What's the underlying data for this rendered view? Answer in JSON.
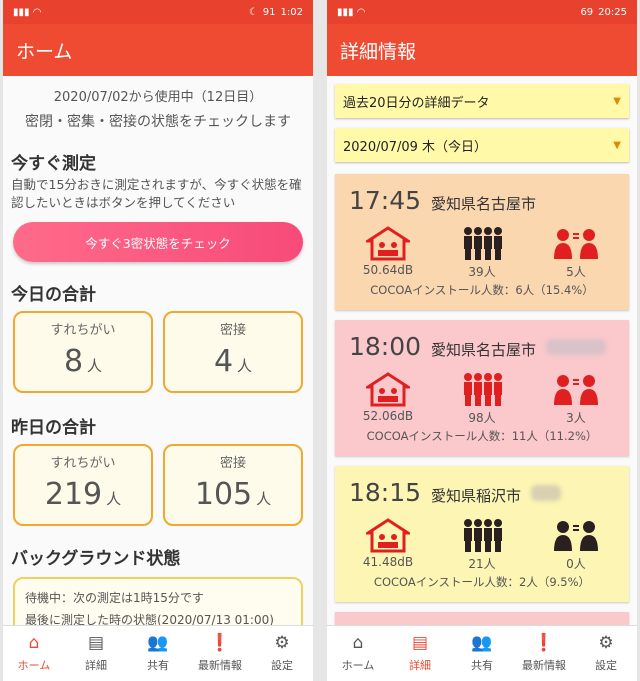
{
  "left": {
    "status": {
      "time": "1:02",
      "battery": "91"
    },
    "title": "ホーム",
    "usage": "2020/07/02から使用中（12日目）",
    "tagline": "密閉・密集・密接の状態をチェックします",
    "measure": {
      "title": "今すぐ測定",
      "desc": "自動で15分おきに測定されますが、今すぐ状態を確認したいときはボタンを押してください",
      "button": "今すぐ3密状態をチェック"
    },
    "today": {
      "title": "今日の合計",
      "cards": [
        {
          "label": "すれちがい",
          "value": "8",
          "unit": "人"
        },
        {
          "label": "密接",
          "value": "4",
          "unit": "人"
        }
      ]
    },
    "yesterday": {
      "title": "昨日の合計",
      "cards": [
        {
          "label": "すれちがい",
          "value": "219",
          "unit": "人"
        },
        {
          "label": "密接",
          "value": "105",
          "unit": "人"
        }
      ]
    },
    "background": {
      "title": "バックグラウンド状態",
      "line1": "待機中：次の測定は1時15分です",
      "line2": "最後に測定した時の状態(2020/07/13 01:00)"
    }
  },
  "right": {
    "status": {
      "time": "20:25",
      "battery": "69"
    },
    "title": "詳細情報",
    "range": "過去20日分の詳細データ",
    "date": "2020/07/09 木（今日）",
    "entries": [
      {
        "time": "17:45",
        "place": "愛知県名古屋市",
        "db": "50.64dB",
        "people": "39人",
        "close": "5人",
        "cocoa": "COCOAインストール人数：6人（15.4%）"
      },
      {
        "time": "18:00",
        "place": "愛知県名古屋市",
        "db": "52.06dB",
        "people": "98人",
        "close": "3人",
        "cocoa": "COCOAインストール人数：11人（11.2%）"
      },
      {
        "time": "18:15",
        "place": "愛知県稲沢市",
        "db": "41.48dB",
        "people": "21人",
        "close": "0人",
        "cocoa": "COCOAインストール人数：2人（9.5%）"
      }
    ]
  },
  "nav": {
    "home": "ホーム",
    "detail": "詳細",
    "share": "共有",
    "news": "最新情報",
    "settings": "設定"
  },
  "colors": {
    "accent": "#ef4a32",
    "red_icon": "#e02020",
    "dark_icon": "#2a2020"
  }
}
